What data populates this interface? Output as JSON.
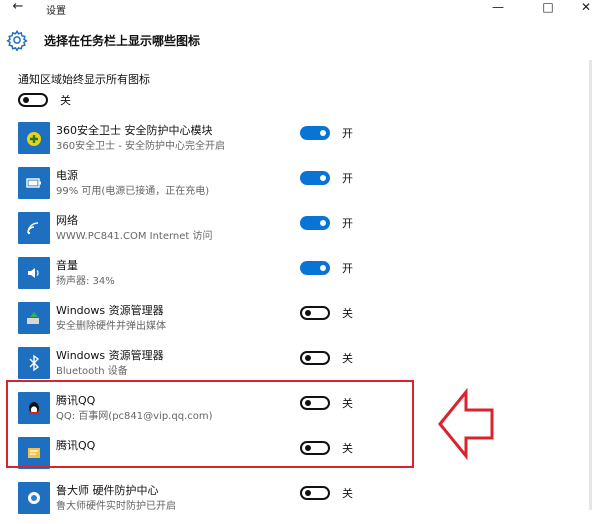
{
  "window": {
    "back_glyph": "←",
    "title": "设置",
    "minimize_glyph": "—",
    "maximize_glyph": "□",
    "close_glyph": "✕"
  },
  "header": {
    "icon": "gear-icon",
    "title": "选择在任务栏上显示哪些图标"
  },
  "master": {
    "label": "通知区域始终显示所有图标",
    "state": "关",
    "on": false
  },
  "items": [
    {
      "name": "360安全卫士 安全防护中心模块",
      "subtitle": "360安全卫士 - 安全防护中心完全开启",
      "state": "开",
      "on": true,
      "icon": "shield-plus-icon"
    },
    {
      "name": "电源",
      "subtitle": "99% 可用(电源已接通，正在充电)",
      "state": "开",
      "on": true,
      "icon": "battery-icon"
    },
    {
      "name": "网络",
      "subtitle": "WWW.PC841.COM Internet 访问",
      "state": "开",
      "on": true,
      "icon": "wifi-icon"
    },
    {
      "name": "音量",
      "subtitle": "扬声器: 34%",
      "state": "开",
      "on": true,
      "icon": "speaker-icon"
    },
    {
      "name": "Windows 资源管理器",
      "subtitle": "安全删除硬件并弹出媒体",
      "state": "关",
      "on": false,
      "icon": "usb-eject-icon"
    },
    {
      "name": "Windows 资源管理器",
      "subtitle": "Bluetooth 设备",
      "state": "关",
      "on": false,
      "icon": "bluetooth-icon"
    },
    {
      "name": "腾讯QQ",
      "subtitle": "QQ: 百事网(pc841@vip.qq.com)",
      "state": "关",
      "on": false,
      "icon": "qq-penguin-icon"
    },
    {
      "name": "腾讯QQ",
      "subtitle": "",
      "state": "关",
      "on": false,
      "icon": "qq-app-icon"
    },
    {
      "name": "鲁大师 硬件防护中心",
      "subtitle": "鲁大师硬件实时防护已开启",
      "state": "关",
      "on": false,
      "icon": "ludashi-icon"
    }
  ],
  "colors": {
    "accent": "#0a74d6",
    "highlight": "#d9232d",
    "icon_tile": "#1e6fbf"
  }
}
